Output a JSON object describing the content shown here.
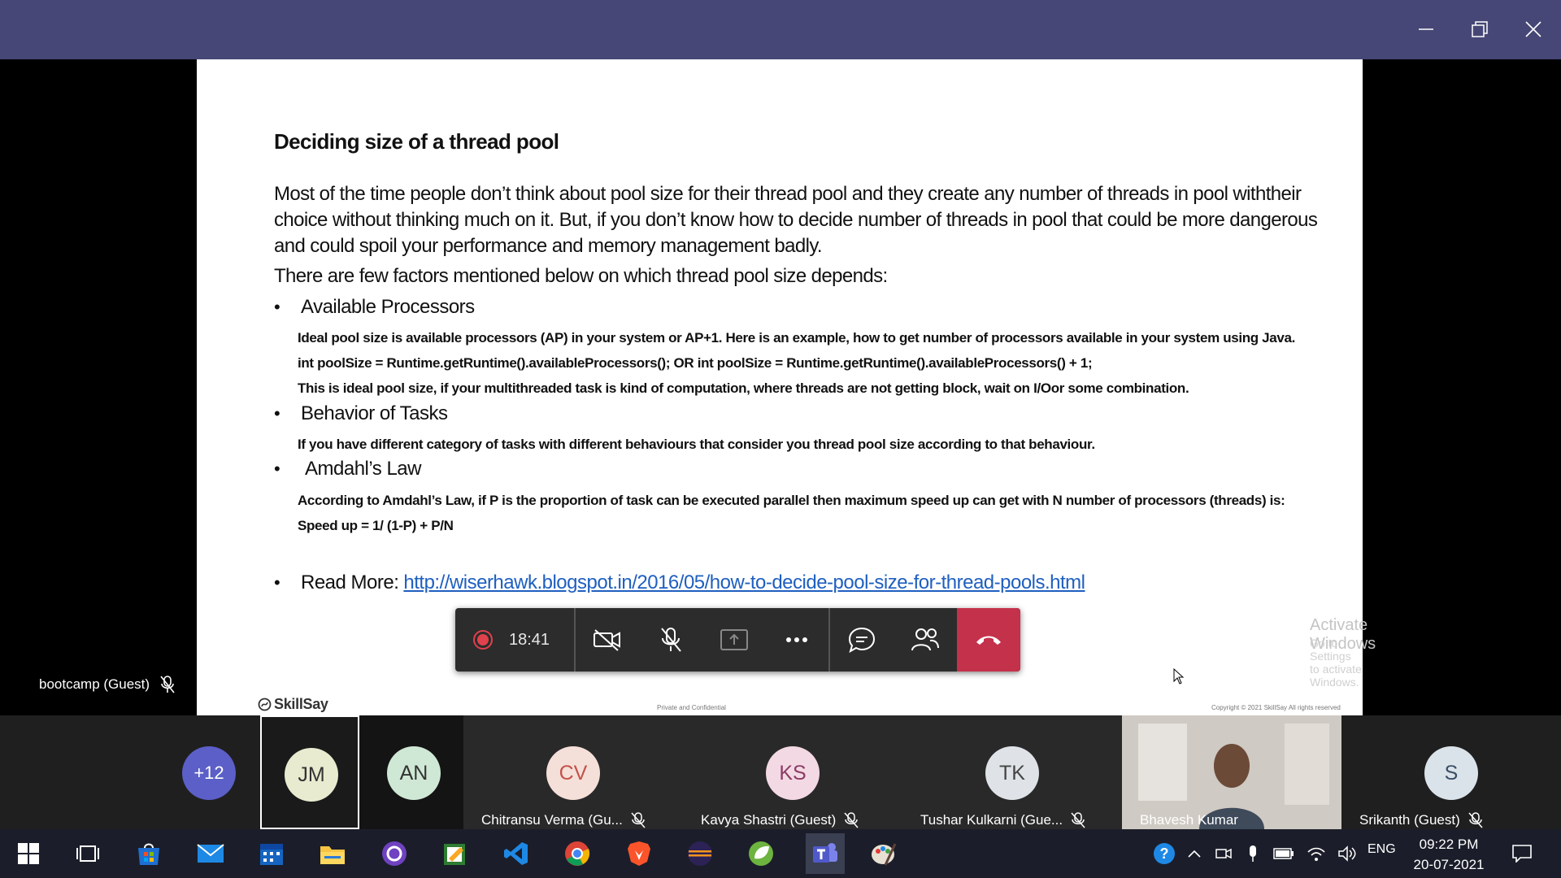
{
  "titlebar": {
    "minimize": "minimize",
    "restore": "restore",
    "close": "close"
  },
  "slide": {
    "title": "Deciding size of a thread pool",
    "intro": "Most of the time people don’t think about pool size for their thread pool and they create any number of threads in pool withtheir choice without thinking much on it. But, if you don’t know how to decide number of threads in pool that could be more dangerous and could spoil your performance and memory management badly.",
    "factors_heading": "There are few factors mentioned below on which thread pool size depends:",
    "bullet1": "Available Processors",
    "b1_line1": "Ideal pool size is available processors (AP) in your system or AP+1. Here is an example, how to get number of processors available in your system using Java.",
    "b1_line2": "int poolSize  = Runtime.getRuntime().availableProcessors(); OR int poolSize = Runtime.getRuntime().availableProcessors() + 1;",
    "b1_line3": "This is ideal pool size, if your multithreaded task is kind of computation, where threads are not getting block, wait on I/Oor some combination.",
    "bullet2": "Behavior of Tasks",
    "b2_line1": "If you have different category of tasks with different behaviours that consider you thread pool size according to that behaviour.",
    "bullet3": "Amdahl’s Law",
    "b3_line1": "According to Amdahl’s Law, if P is the proportion of task can be executed parallel then maximum speed up can get with N number of processors (threads) is:",
    "b3_line2": "Speed up = 1/ (1-P) + P/N",
    "readmore_label": "Read More:",
    "readmore_url": "http://wiserhawk.blogspot.in/2016/05/how-to-decide-pool-size-for-thread-pools.html",
    "brand": "SkillSay",
    "footer_center": "Private and Confidential",
    "footer_right": "Copyright © 2021 SkillSay All rights reserved",
    "watermark_title": "Activate Windows",
    "watermark_sub": "Go to Settings to activate Windows."
  },
  "controls": {
    "timer": "18:41"
  },
  "self_view": {
    "name": "bootcamp (Guest)"
  },
  "participants": {
    "overflow": "+12",
    "jm": "JM",
    "an": "AN",
    "cv": {
      "initials": "CV",
      "name": "Chitransu Verma (Gu..."
    },
    "ks": {
      "initials": "KS",
      "name": "Kavya Shastri (Guest)"
    },
    "tk": {
      "initials": "TK",
      "name": "Tushar Kulkarni (Gue..."
    },
    "bk": {
      "name": "Bhavesh Kumar"
    },
    "s": {
      "initials": "S",
      "name": "Srikanth (Guest)"
    }
  },
  "taskbar": {
    "lang": "ENG",
    "time": "09:22 PM",
    "date": "20-07-2021"
  },
  "colors": {
    "titlebar": "#464776",
    "hangup": "#c4314b",
    "record": "#e0414c",
    "link": "#1f5fbf"
  }
}
